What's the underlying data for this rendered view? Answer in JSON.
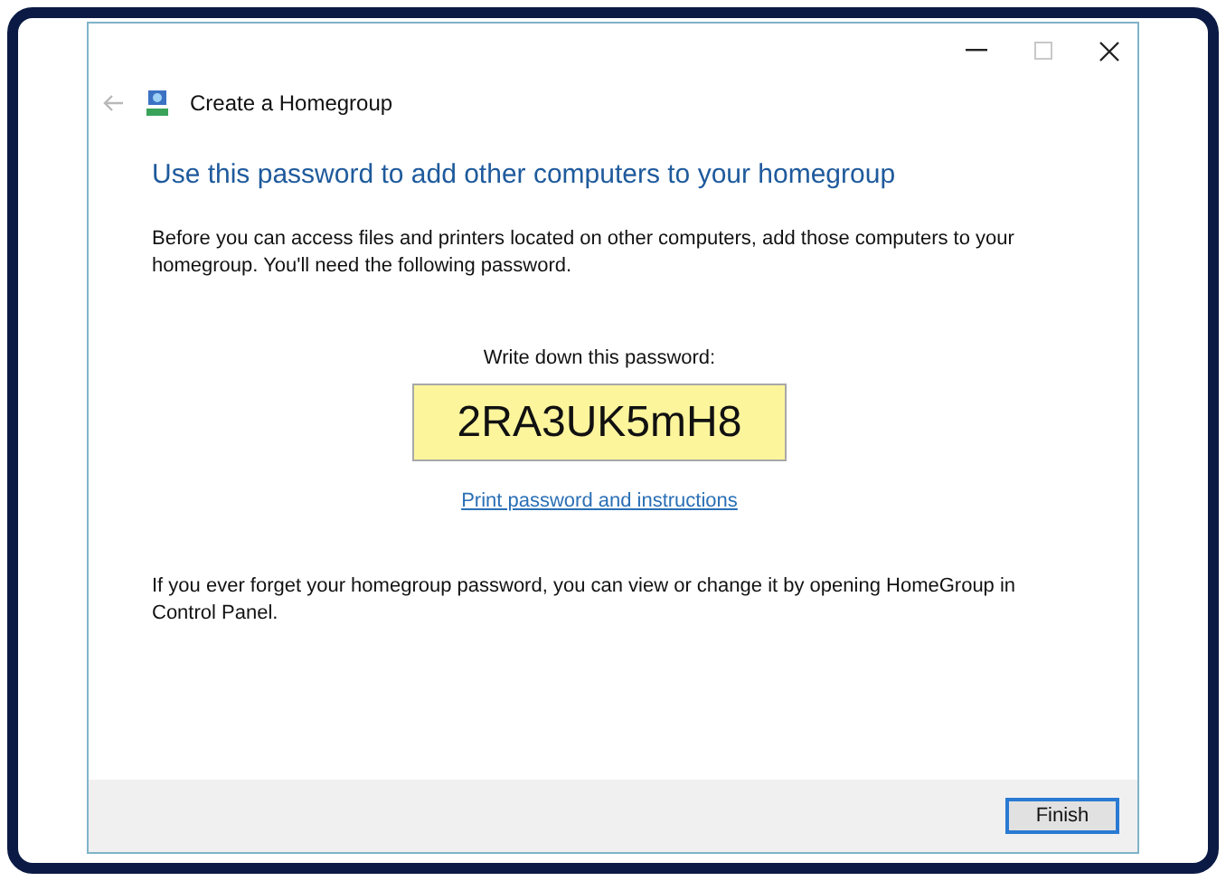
{
  "window": {
    "back_disabled": true,
    "title": "Create a Homegroup"
  },
  "heading": "Use this password to add other computers to your homegroup",
  "intro": "Before you can access files and printers located on other computers, add those computers to your homegroup. You'll need the following password.",
  "password_label": "Write down this password:",
  "password": "2RA3UK5mH8",
  "print_link": "Print password and instructions",
  "note": "If you ever forget your homegroup password, you can view or change it by opening HomeGroup in Control Panel.",
  "buttons": [
    {
      "label": "Finish",
      "focused": true
    }
  ]
}
